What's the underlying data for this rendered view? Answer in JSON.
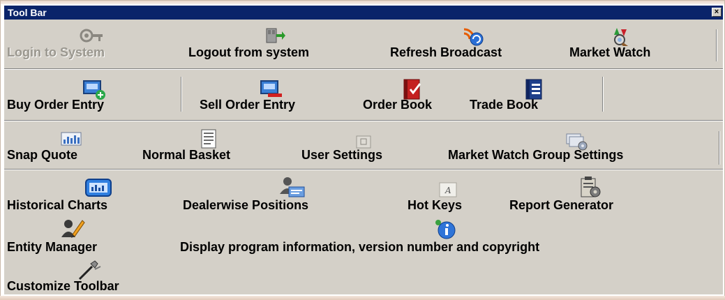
{
  "window": {
    "title": "Tool Bar",
    "close_glyph": "×"
  },
  "toolbar": {
    "login": {
      "label": "Login to System",
      "icon": "key-icon"
    },
    "logout": {
      "label": "Logout from system",
      "icon": "logout-door-icon"
    },
    "refresh": {
      "label": "Refresh Broadcast",
      "icon": "broadcast-refresh-icon"
    },
    "market_watch": {
      "label": "Market Watch",
      "icon": "binoculars-icon"
    },
    "buy_order": {
      "label": "Buy Order Entry",
      "icon": "buy-order-icon"
    },
    "sell_order": {
      "label": "Sell Order Entry",
      "icon": "sell-order-icon"
    },
    "order_book": {
      "label": "Order Book",
      "icon": "order-book-icon"
    },
    "trade_book": {
      "label": "Trade Book",
      "icon": "trade-book-icon"
    },
    "snap_quote": {
      "label": "Snap Quote",
      "icon": "snap-quote-icon"
    },
    "normal_basket": {
      "label": "Normal Basket",
      "icon": "basket-document-icon"
    },
    "user_settings": {
      "label": "User Settings",
      "icon": "settings-icon"
    },
    "mw_group_settings": {
      "label": "Market Watch Group Settings",
      "icon": "group-settings-icon"
    },
    "historical_charts": {
      "label": "Historical Charts",
      "icon": "chart-icon"
    },
    "dealerwise_positions": {
      "label": "Dealerwise Positions",
      "icon": "dealer-user-icon"
    },
    "hot_keys": {
      "label": "Hot Keys",
      "icon": "keyboard-key-icon"
    },
    "report_generator": {
      "label": "Report Generator",
      "icon": "report-clipboard-icon"
    },
    "entity_manager": {
      "label": "Entity Manager",
      "icon": "entity-user-edit-icon"
    },
    "about": {
      "label": "Display program information, version number and copyright",
      "icon": "info-icon"
    },
    "customize": {
      "label": "Customize Toolbar",
      "icon": "tools-icon"
    }
  }
}
